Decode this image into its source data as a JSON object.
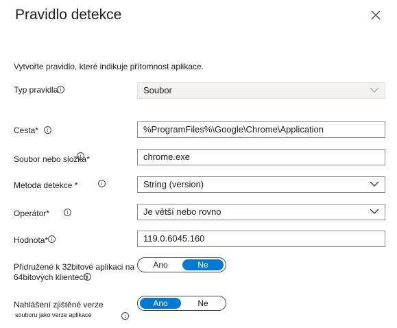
{
  "panel": {
    "title": "Pravidlo detekce",
    "description": "Vytvořte pravidlo, které indikuje přítomnost aplikace."
  },
  "fields": {
    "rule_type": {
      "label": "Typ pravidla",
      "value": "Soubor"
    },
    "path": {
      "label": "Cesta",
      "required": "*",
      "value": "%ProgramFiles%\\Google\\Chrome\\Application"
    },
    "file_or_folder": {
      "label": "Soubor nebo složka",
      "required": "*",
      "value": "chrome.exe"
    },
    "detection_method": {
      "label": "Metoda detekce",
      "required": " *",
      "value": "String (version)"
    },
    "operator": {
      "label": "Operátor",
      "required": "*",
      "value": "Je větší nebo rovno"
    },
    "value": {
      "label": "Hodnota",
      "required": "*",
      "value": "119.0.6045.160"
    },
    "bit32": {
      "label_line1": "Přidružené k 32bitové aplikaci na",
      "label_line2": "64bitových klientech",
      "option_yes": "Ano",
      "option_no": "Ne",
      "selected": "Ne"
    },
    "report_version": {
      "label_line1": "Nahlášení zjištěné verze",
      "label_line2": "souboru jako verze aplikace",
      "option_yes": "Ano",
      "option_no": "Ne",
      "selected": "Ano"
    }
  },
  "icons": {
    "info": "info-icon",
    "close": "close-icon",
    "chevron": "chevron-down-icon"
  },
  "colors": {
    "accent": "#0078d4",
    "border": "#8a8886"
  }
}
